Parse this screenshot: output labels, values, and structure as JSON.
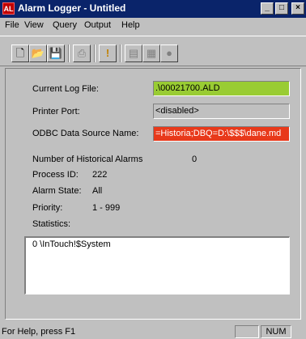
{
  "window": {
    "title": "Alarm Logger - Untitled",
    "icon_text": "AL",
    "minimize_glyph": "_",
    "maximize_glyph": "□",
    "close_glyph": "×"
  },
  "menu": {
    "items": [
      {
        "label": "File",
        "mnemonic": "F"
      },
      {
        "label": "View",
        "mnemonic": "V"
      },
      {
        "label": "Query",
        "mnemonic": "Q"
      },
      {
        "label": "Output",
        "mnemonic": "O"
      },
      {
        "label": "Help",
        "mnemonic": "H"
      }
    ]
  },
  "toolbar": {
    "buttons": [
      {
        "name": "new-icon",
        "glyph": "🗋",
        "enabled": true
      },
      {
        "name": "open-icon",
        "glyph": "📂",
        "enabled": true
      },
      {
        "name": "save-icon",
        "glyph": "💾",
        "enabled": true
      },
      {
        "name": "print-icon",
        "glyph": "⎙",
        "enabled": false
      },
      {
        "name": "exclamation-icon",
        "glyph": "!",
        "enabled": true
      },
      {
        "name": "historical-icon",
        "glyph": "▤",
        "enabled": false
      },
      {
        "name": "query-icon",
        "glyph": "▦",
        "enabled": false
      },
      {
        "name": "pointer-icon",
        "glyph": "●",
        "enabled": false
      }
    ]
  },
  "form": {
    "current_log_file_label": "Current Log File:",
    "current_log_file_value": ".\\00021700.ALD",
    "printer_port_label": "Printer Port:",
    "printer_port_value": "<disabled>",
    "odbc_label": "ODBC Data Source Name:",
    "odbc_value": "=Historia;DBQ=D:\\$$$\\dane.md",
    "historical_alarms_label": "Number of Historical Alarms",
    "historical_alarms_value": "0",
    "process_id_label": "Process ID:",
    "process_id_value": "222",
    "alarm_state_label": "Alarm State:",
    "alarm_state_value": "All",
    "priority_label": "Priority:",
    "priority_value": "1 - 999",
    "statistics_label": "Statistics:",
    "statistics_items": [
      "0 \\InTouch!$System"
    ]
  },
  "status": {
    "help_text": "For Help, press F1",
    "num_indicator": "NUM"
  },
  "colors": {
    "title_bar": "#0a246a",
    "log_file_field": "#99cc33",
    "odbc_field": "#e8391a",
    "face": "#c0c0c0"
  }
}
